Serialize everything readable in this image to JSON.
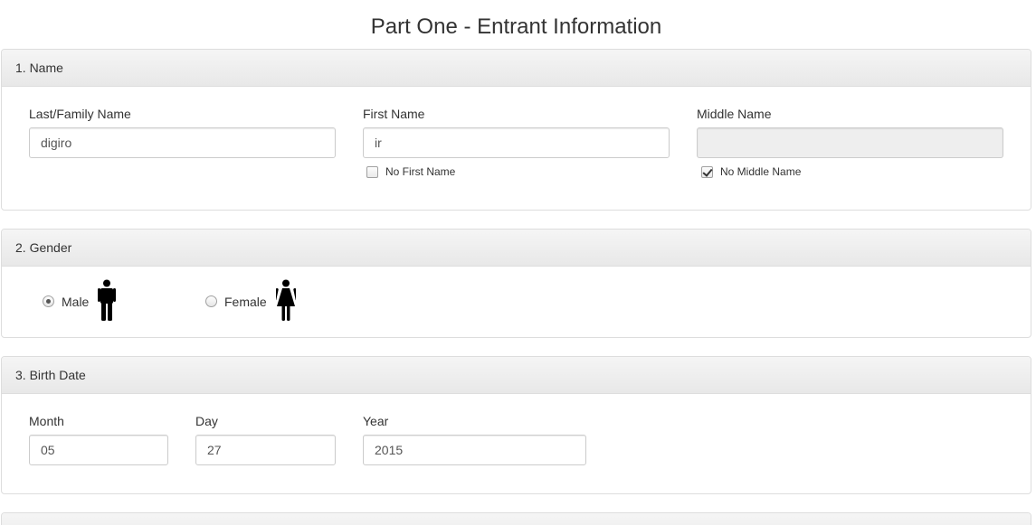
{
  "page": {
    "title": "Part One - Entrant Information"
  },
  "name_section": {
    "heading": "1. Name",
    "last_name": {
      "label": "Last/Family Name",
      "value": "digiro"
    },
    "first_name": {
      "label": "First Name",
      "value": "ir"
    },
    "middle_name": {
      "label": "Middle Name",
      "value": ""
    },
    "no_first_name": {
      "label": "No First Name",
      "checked": false
    },
    "no_middle_name": {
      "label": "No Middle Name",
      "checked": true
    }
  },
  "gender_section": {
    "heading": "2. Gender",
    "options": [
      {
        "label": "Male",
        "selected": true,
        "icon": "male-figure-icon"
      },
      {
        "label": "Female",
        "selected": false,
        "icon": "female-figure-icon"
      }
    ]
  },
  "birth_section": {
    "heading": "3. Birth Date",
    "month": {
      "label": "Month",
      "value": "05"
    },
    "day": {
      "label": "Day",
      "value": "27"
    },
    "year": {
      "label": "Year",
      "value": "2015"
    }
  }
}
